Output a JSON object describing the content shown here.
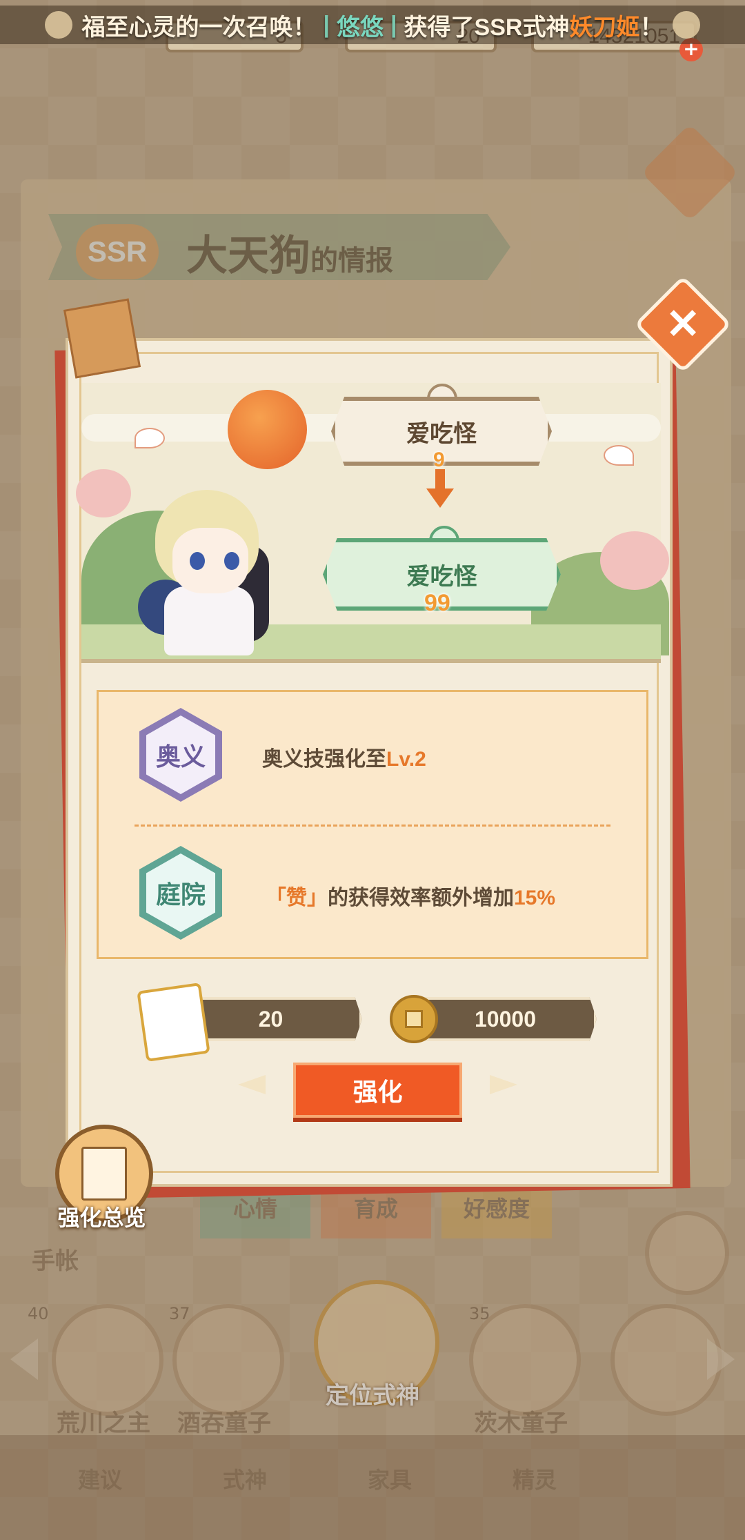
{
  "ticker": {
    "part1": "福至心灵的一次召唤！",
    "sep": "|",
    "player": "悠悠",
    "part2": "获得了SSR式神",
    "shikigami": "妖刀姬",
    "end": "！"
  },
  "resources": [
    {
      "value": "5",
      "icon": "card-icon"
    },
    {
      "value": "20",
      "icon": "card-icon"
    },
    {
      "value": "14521051",
      "icon": "coin-icon"
    }
  ],
  "info_book": {
    "rarity": "SSR",
    "name": "大天狗",
    "suffix": "的情报"
  },
  "upgrade": {
    "title_from": "爱吃怪",
    "level_from": "9",
    "title_to": "爱吃怪",
    "level_to": "99"
  },
  "effects": [
    {
      "badge": "奥义",
      "text": "奥义技强化至",
      "highlight": "Lv.2"
    },
    {
      "badge": "庭院",
      "text_pre": "「赞」",
      "text": "的获得效率额外增加",
      "highlight": "15%"
    }
  ],
  "costs": {
    "cards": "20",
    "coins": "10000"
  },
  "buttons": {
    "enhance": "强化",
    "overview": "强化总览"
  },
  "background_tabs": [
    "心情",
    "育成",
    "好感度"
  ],
  "handbook_label": "手帐",
  "roster": [
    {
      "name": "荒川之主",
      "level": "40"
    },
    {
      "name": "酒吞童子",
      "level": "37"
    },
    {
      "name": "定位式神",
      "level": ""
    },
    {
      "name": "茨木童子",
      "level": "35"
    }
  ],
  "bottom_nav": [
    "建议",
    "式神",
    "家具",
    "精灵"
  ],
  "colors": {
    "accent": "#f05a25",
    "card_red": "#c14a35",
    "green_plate": "#5ca677",
    "purple_badge": "#8b7bb5",
    "teal_badge": "#5fa594"
  }
}
